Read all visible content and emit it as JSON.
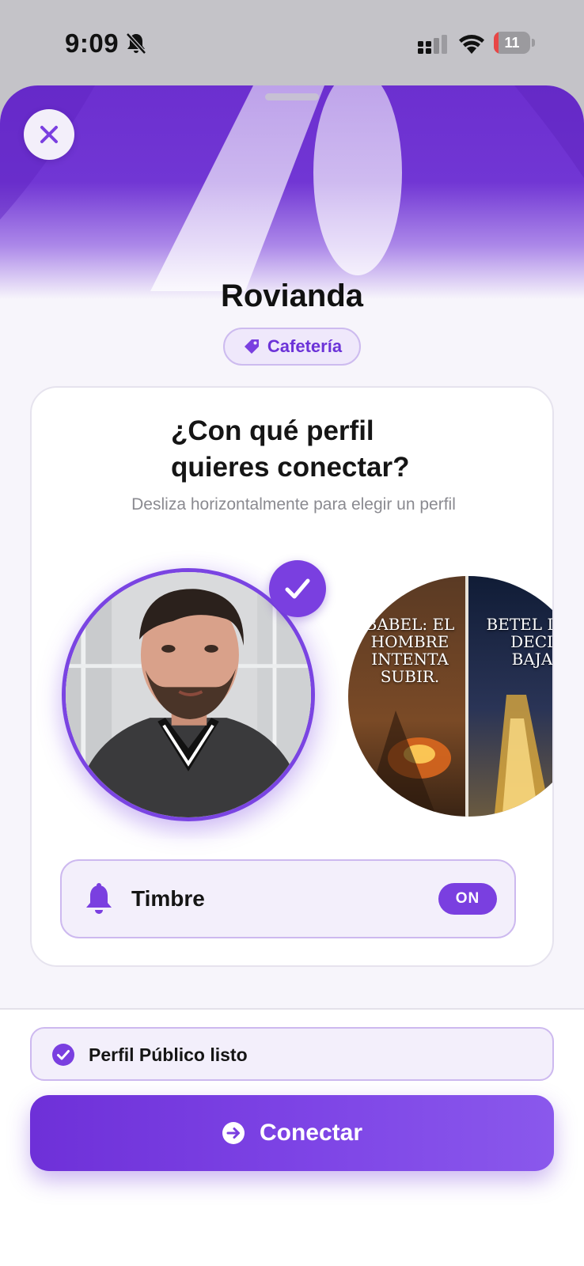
{
  "status_bar": {
    "time": "9:09",
    "battery_percent": "11",
    "icons": [
      "bell-slash-icon",
      "cellular-signal-icon",
      "wifi-icon",
      "battery-icon"
    ]
  },
  "business": {
    "name": "Rovianda",
    "category": "Cafetería"
  },
  "profile_picker": {
    "title": "¿Con qué perfil quieres conectar?",
    "subtitle": "Desliza horizontalmente para elegir un perfil",
    "profiles": [
      {
        "kind": "photo",
        "selected": true
      },
      {
        "kind": "poster",
        "selected": false,
        "left_text": "BABEL: EL HOMBRE INTENTA SUBIR.",
        "right_text": "BETEL DIOS DECID BAJAR"
      }
    ]
  },
  "doorbell": {
    "label": "Timbre",
    "state": "ON"
  },
  "footer": {
    "status": "Perfil Público listo",
    "connect_label": "Conectar"
  },
  "colors": {
    "accent": "#7a3fe0",
    "accent_dark": "#6c2fcf",
    "pill_bg": "#efe8fb",
    "pill_border": "#cdb9ef"
  }
}
